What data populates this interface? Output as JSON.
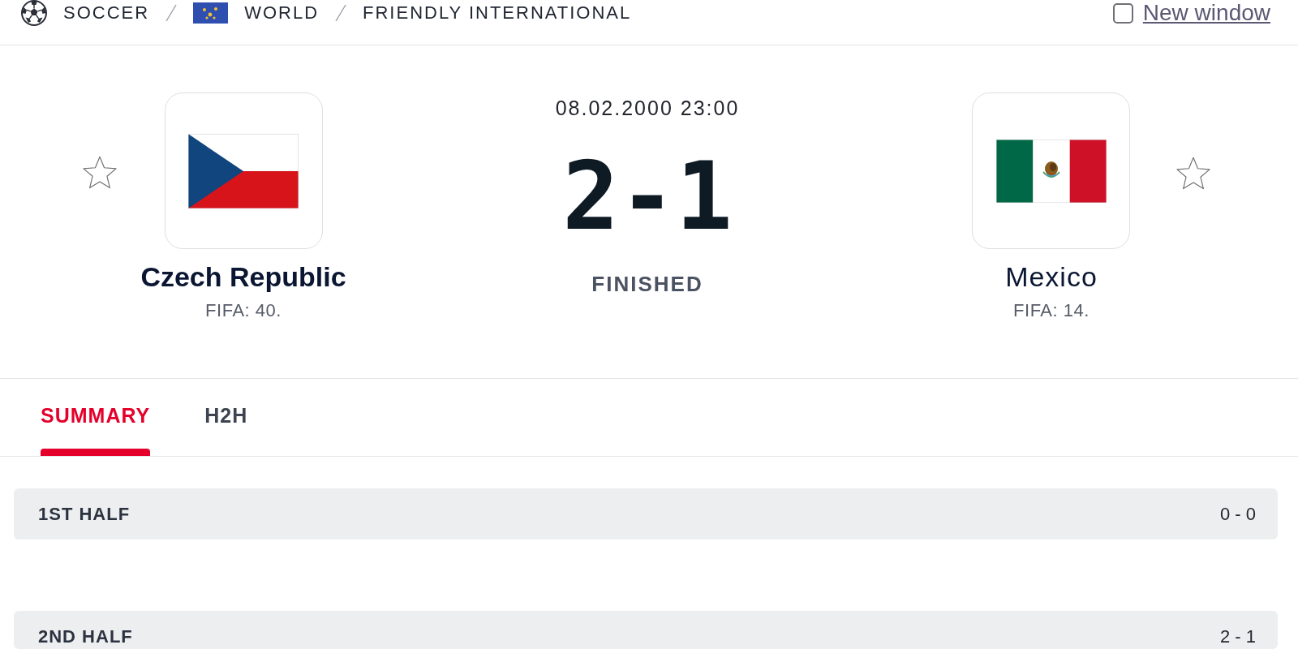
{
  "breadcrumb": [
    {
      "kind": "sport",
      "label": "SOCCER"
    },
    {
      "kind": "region",
      "label": "WORLD"
    },
    {
      "kind": "competition",
      "label": "FRIENDLY INTERNATIONAL"
    }
  ],
  "new_window": {
    "label": "New window",
    "checked": false
  },
  "match": {
    "date": "08.02.2000 23:00",
    "score": "2-1",
    "status": "FINISHED",
    "home": {
      "name": "Czech Republic",
      "rank": "FIFA: 40.",
      "winner": true,
      "favorite": false
    },
    "away": {
      "name": "Mexico",
      "rank": "FIFA: 14.",
      "winner": false,
      "favorite": false
    }
  },
  "tabs": [
    {
      "label": "SUMMARY",
      "selected": true
    },
    {
      "label": "H2H",
      "selected": false
    }
  ],
  "periods": [
    {
      "label": "1ST HALF",
      "score": "0 - 0"
    },
    {
      "label": "2ND HALF",
      "score": "2 - 1"
    }
  ]
}
